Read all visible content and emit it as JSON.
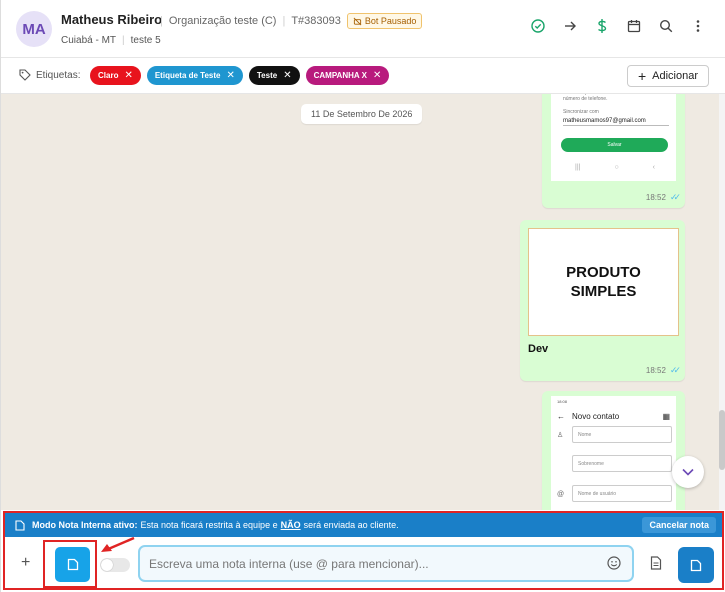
{
  "contact": {
    "initials": "MA",
    "name": "Matheus Ribeiro",
    "organization": "Organização teste (C)",
    "ticket": "T#383093",
    "bot_status": "Bot Pausado",
    "location": "Cuiabá - MT",
    "department": "teste 5"
  },
  "header_icons": [
    "check-circle-icon",
    "arrow-right-icon",
    "dollar-icon",
    "calendar-icon",
    "search-icon",
    "more-vertical-icon"
  ],
  "labels": {
    "title": "Etiquetas:",
    "chips": [
      {
        "label": "Claro",
        "color": "#e8131d"
      },
      {
        "label": "Etiqueta de Teste",
        "color": "#1f96d0"
      },
      {
        "label": "Teste",
        "color": "#111111"
      },
      {
        "label": "CAMPANHA X",
        "color": "#b81a7d"
      }
    ],
    "add_label": "Adicionar"
  },
  "chat": {
    "date": "11 De Setembro De 2026",
    "messages": [
      {
        "time": "18:52",
        "shot_text": "contatos que tenham um número de telefone.",
        "shot_account_label": "Sincronizar com",
        "shot_email": "matheusmamos97@gmail.com",
        "shot_button": "Salvar"
      },
      {
        "time": "18:52",
        "image_line1": "PRODUTO",
        "image_line2": "SIMPLES",
        "caption": "Dev"
      },
      {
        "shot_status_time": "18:08",
        "shot_title": "Novo contato",
        "shot_fields": [
          "Nome",
          "Sobrenome",
          "Nome de usuário"
        ]
      }
    ]
  },
  "composer": {
    "banner_title": "Modo Nota Interna ativo:",
    "banner_text_1": "Esta nota ficará restrita à equipe e",
    "banner_emphasis": "NÃO",
    "banner_text_2": "será enviada ao cliente.",
    "cancel_label": "Cancelar nota",
    "placeholder": "Escreva uma nota interna (use @ para mencionar)..."
  },
  "colors": {
    "accent": "#1a7fc8",
    "note_button": "#17a3e8",
    "bubble": "#d9fdd3",
    "chat_bg": "#efeae2",
    "highlight": "#e02424"
  }
}
